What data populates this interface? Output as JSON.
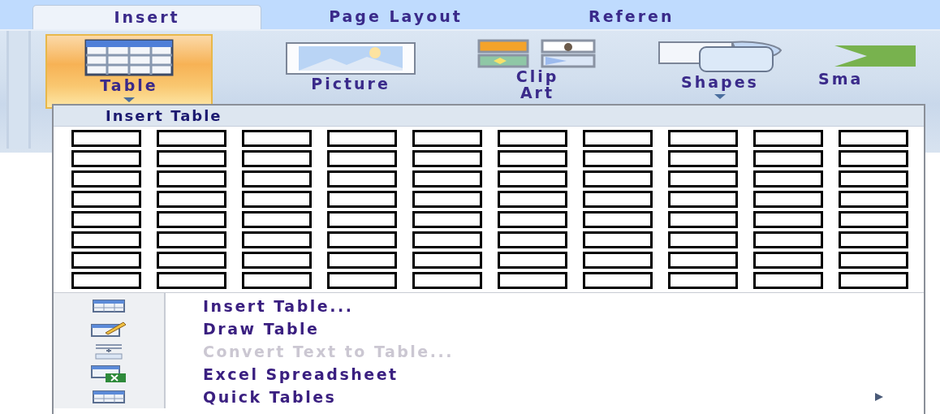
{
  "tabs": [
    {
      "label": "Insert",
      "selected": true
    },
    {
      "label": "Page Layout",
      "selected": false
    },
    {
      "label": "Referen",
      "selected": false
    }
  ],
  "ribbon_buttons": [
    {
      "kind": "table",
      "label": "Table",
      "dropdown": true,
      "selected": true
    },
    {
      "kind": "picture",
      "label": "Picture",
      "dropdown": false,
      "selected": false
    },
    {
      "kind": "clipart",
      "label": "Clip Art",
      "dropdown": false,
      "selected": false
    },
    {
      "kind": "shapes",
      "label": "Shapes",
      "dropdown": true,
      "selected": false
    },
    {
      "kind": "smartart",
      "label": "Sma",
      "dropdown": false,
      "selected": false
    }
  ],
  "menu": {
    "header": "Insert Table",
    "grid": [
      {
        "cells": [
          {
            "selected": false
          },
          {
            "selected": false
          },
          {
            "selected": false
          },
          {
            "selected": false
          },
          {
            "selected": false
          },
          {
            "selected": false
          },
          {
            "selected": false
          },
          {
            "selected": false
          },
          {
            "selected": false
          },
          {
            "selected": false
          }
        ]
      },
      {
        "cells": [
          {
            "selected": false
          },
          {
            "selected": false
          },
          {
            "selected": false
          },
          {
            "selected": false
          },
          {
            "selected": false
          },
          {
            "selected": false
          },
          {
            "selected": false
          },
          {
            "selected": false
          },
          {
            "selected": false
          },
          {
            "selected": false
          }
        ]
      },
      {
        "cells": [
          {
            "selected": false
          },
          {
            "selected": false
          },
          {
            "selected": false
          },
          {
            "selected": false
          },
          {
            "selected": false
          },
          {
            "selected": false
          },
          {
            "selected": false
          },
          {
            "selected": false
          },
          {
            "selected": false
          },
          {
            "selected": false
          }
        ]
      },
      {
        "cells": [
          {
            "selected": false
          },
          {
            "selected": false
          },
          {
            "selected": false
          },
          {
            "selected": false
          },
          {
            "selected": false
          },
          {
            "selected": false
          },
          {
            "selected": false
          },
          {
            "selected": false
          },
          {
            "selected": false
          },
          {
            "selected": false
          }
        ]
      },
      {
        "cells": [
          {
            "selected": false
          },
          {
            "selected": false
          },
          {
            "selected": false
          },
          {
            "selected": false
          },
          {
            "selected": false
          },
          {
            "selected": false
          },
          {
            "selected": false
          },
          {
            "selected": false
          },
          {
            "selected": false
          },
          {
            "selected": false
          }
        ]
      },
      {
        "cells": [
          {
            "selected": false
          },
          {
            "selected": false
          },
          {
            "selected": false
          },
          {
            "selected": false
          },
          {
            "selected": false
          },
          {
            "selected": false
          },
          {
            "selected": false
          },
          {
            "selected": false
          },
          {
            "selected": false
          },
          {
            "selected": false
          }
        ]
      },
      {
        "cells": [
          {
            "selected": false
          },
          {
            "selected": false
          },
          {
            "selected": false
          },
          {
            "selected": false
          },
          {
            "selected": false
          },
          {
            "selected": false
          },
          {
            "selected": false
          },
          {
            "selected": false
          },
          {
            "selected": false
          },
          {
            "selected": false
          }
        ]
      },
      {
        "cells": [
          {
            "selected": false
          },
          {
            "selected": false
          },
          {
            "selected": false
          },
          {
            "selected": false
          },
          {
            "selected": false
          },
          {
            "selected": false
          },
          {
            "selected": false
          },
          {
            "selected": false
          },
          {
            "selected": false
          },
          {
            "selected": false
          }
        ]
      }
    ],
    "items": [
      {
        "kind": "table",
        "label": "Insert Table...",
        "disabled": false,
        "submenu": false
      },
      {
        "kind": "draw",
        "label": "Draw Table",
        "disabled": false,
        "submenu": false
      },
      {
        "kind": "convert",
        "label": "Convert Text to Table...",
        "disabled": true,
        "submenu": false
      },
      {
        "kind": "excel",
        "label": "Excel Spreadsheet",
        "disabled": false,
        "submenu": false
      },
      {
        "kind": "quick",
        "label": "Quick Tables",
        "disabled": false,
        "submenu": true
      }
    ]
  }
}
